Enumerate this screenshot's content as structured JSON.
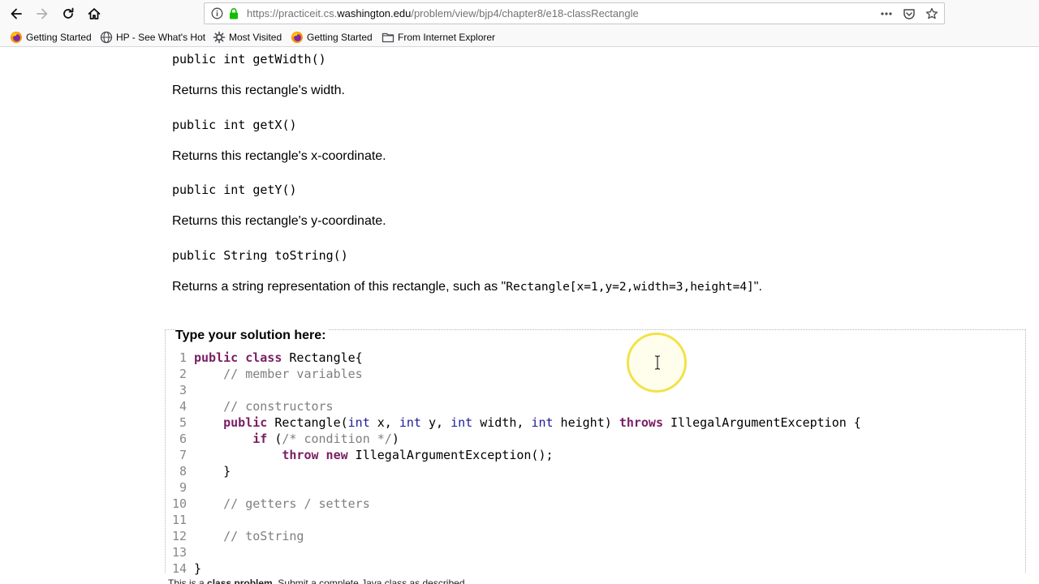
{
  "browser": {
    "url_prefix": "https://practiceit.cs.",
    "url_domain": "washington.edu",
    "url_path": "/problem/view/bjp4/chapter8/e18-classRectangle",
    "bookmarks": [
      {
        "label": "Getting Started",
        "icon": "firefox-icon"
      },
      {
        "label": "HP - See What's Hot",
        "icon": "globe-icon"
      },
      {
        "label": "Most Visited",
        "icon": "gear-icon"
      },
      {
        "label": "Getting Started",
        "icon": "firefox-icon"
      },
      {
        "label": "From Internet Explorer",
        "icon": "folder-icon"
      }
    ]
  },
  "methods": [
    {
      "signature": "public int getWidth()",
      "description": "Returns this rectangle's width."
    },
    {
      "signature": "public int getX()",
      "description": "Returns this rectangle's x-coordinate."
    },
    {
      "signature": "public int getY()",
      "description": "Returns this rectangle's y-coordinate."
    },
    {
      "signature": "public String toString()",
      "description_prefix": "Returns a string representation of this rectangle, such as \"",
      "description_code": "Rectangle[x=1,y=2,width=3,height=4]",
      "description_suffix": "\"."
    }
  ],
  "solution": {
    "title": "Type your solution here:",
    "line_numbers": [
      "1",
      "2",
      "3",
      "4",
      "5",
      "6",
      "7",
      "8",
      "9",
      "10",
      "11",
      "12",
      "13",
      "14"
    ]
  },
  "footer": {
    "prefix": "This is a ",
    "bold": "class problem",
    "suffix": ". Submit a complete Java class as described."
  }
}
